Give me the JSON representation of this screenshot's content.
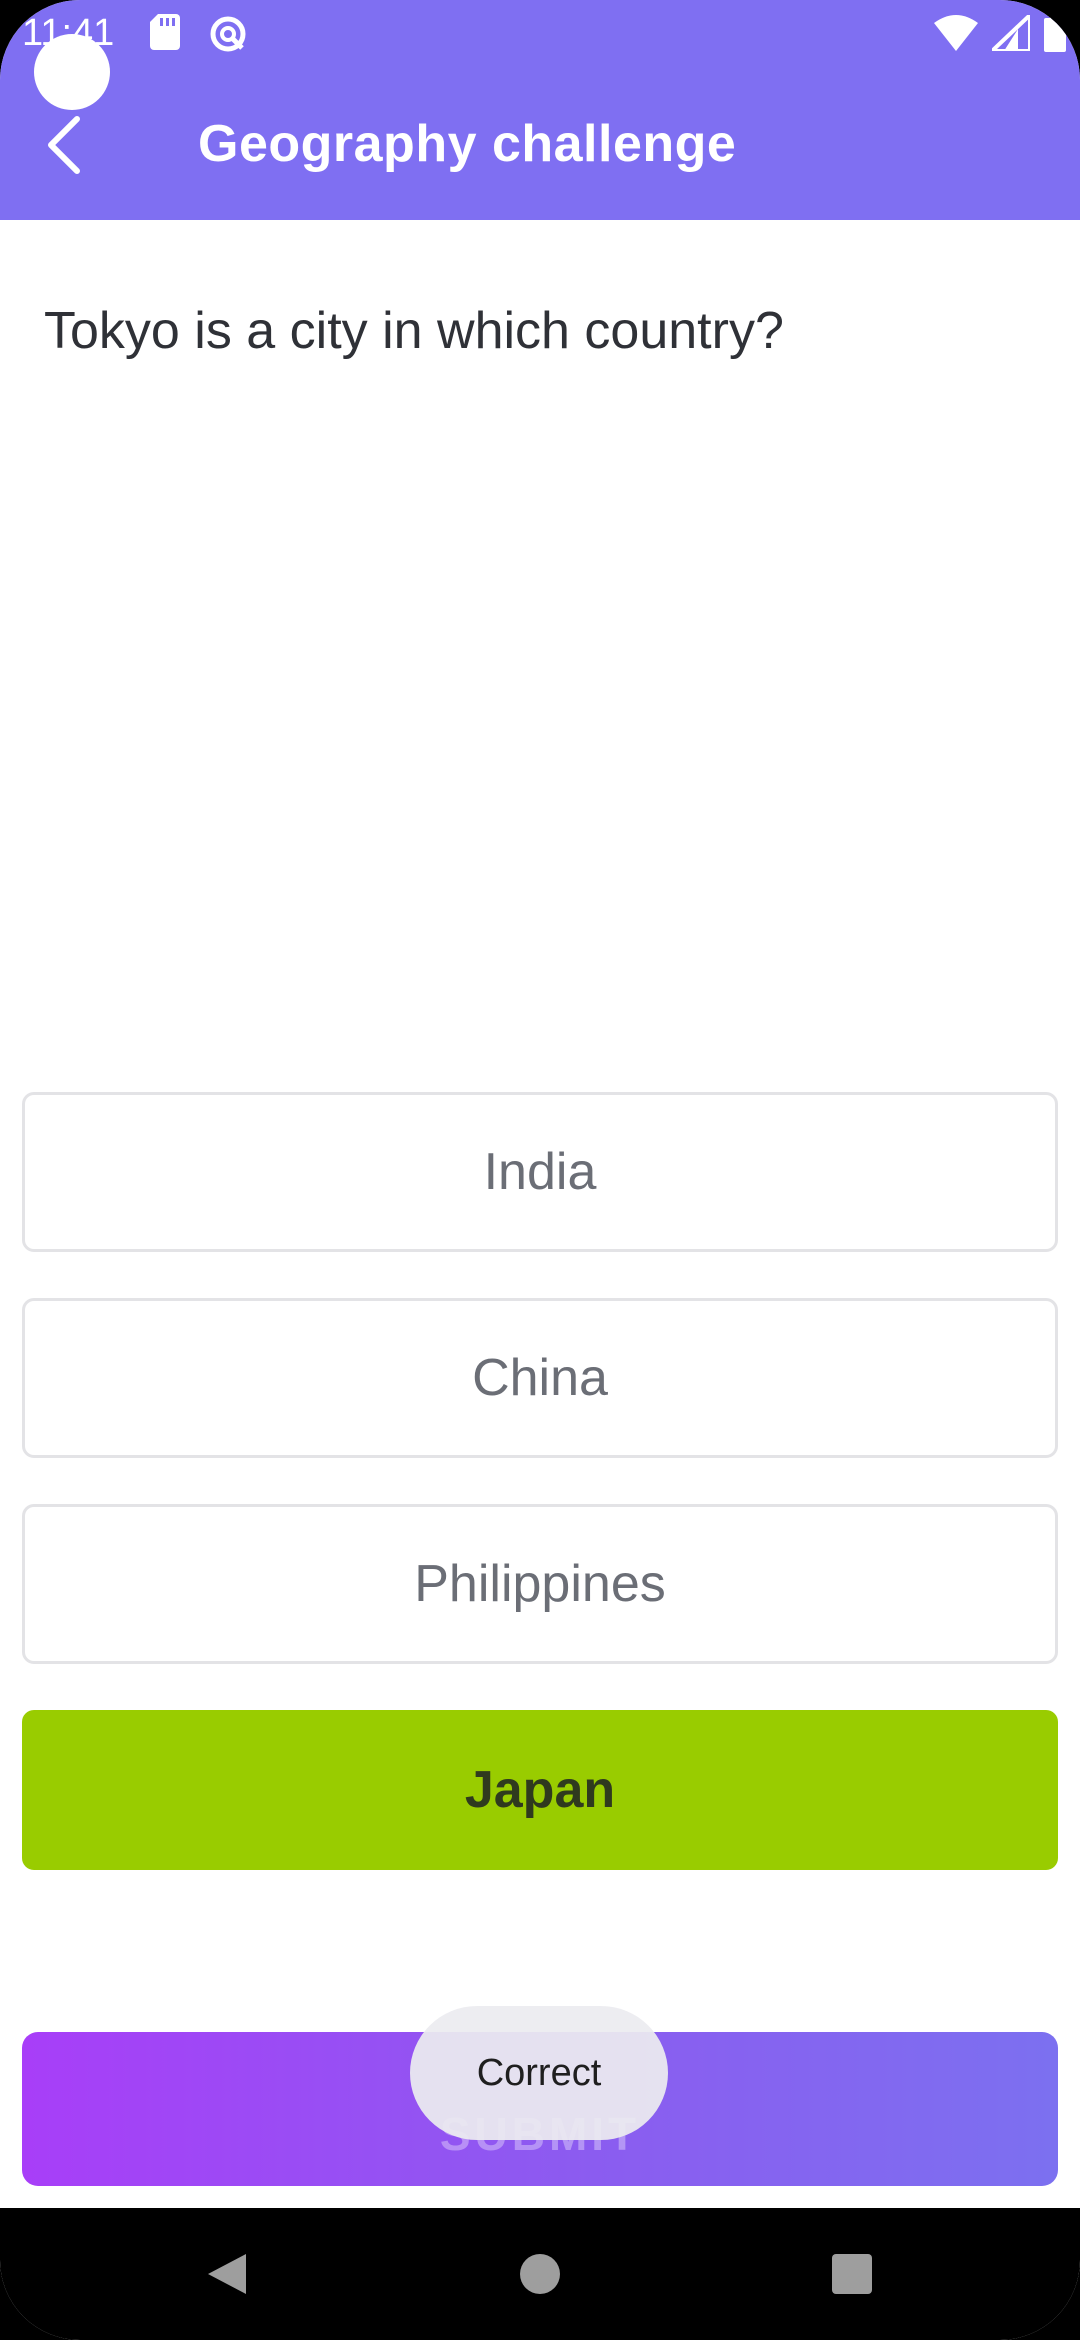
{
  "status_bar": {
    "time": "11:41"
  },
  "app_bar": {
    "title": "Geography challenge",
    "back_icon": "chevron-left-icon"
  },
  "question": {
    "text": "Tokyo is a city in which country?"
  },
  "options": [
    {
      "label": "India",
      "state": "default"
    },
    {
      "label": "China",
      "state": "default"
    },
    {
      "label": "Philippines",
      "state": "default"
    },
    {
      "label": "Japan",
      "state": "correct"
    }
  ],
  "submit": {
    "label": "SUBMIT"
  },
  "toast": {
    "text": "Correct"
  },
  "colors": {
    "header": "#7f6ff2",
    "correct": "#99cc00",
    "submit_gradient_start": "#a83ef8",
    "submit_gradient_end": "#7c70f0"
  },
  "nav_bar": {
    "icons": [
      "back-triangle-icon",
      "home-circle-icon",
      "recents-square-icon"
    ]
  }
}
